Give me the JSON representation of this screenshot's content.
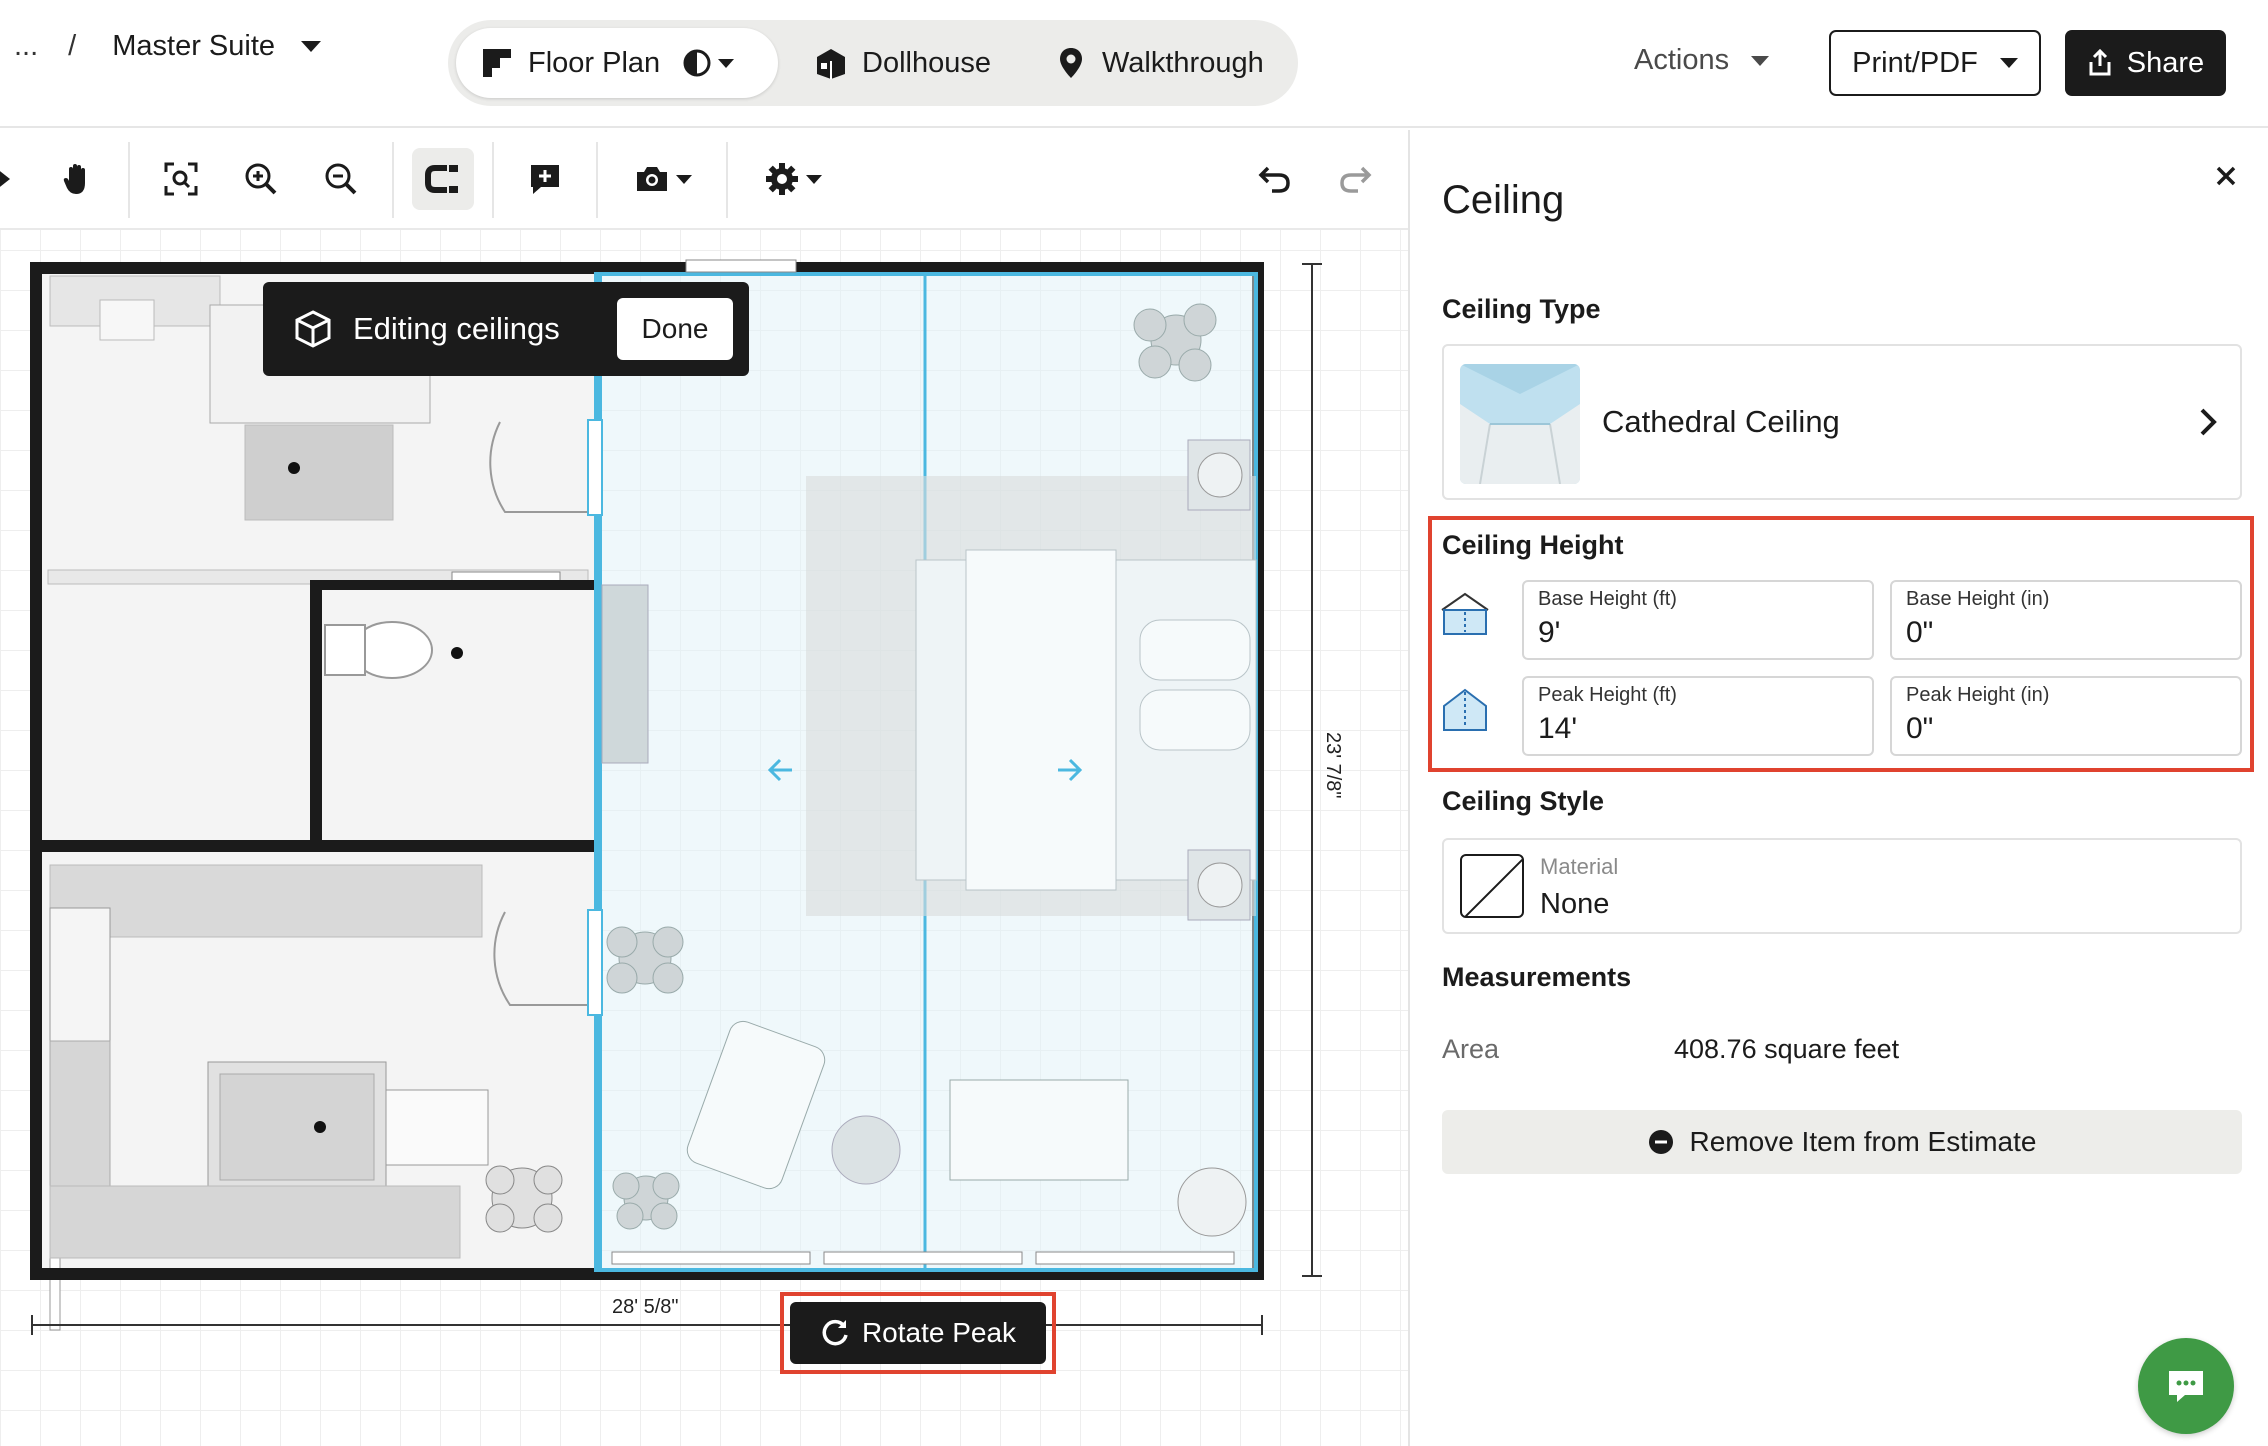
{
  "header": {
    "breadcrumb_ellipsis": "...",
    "breadcrumb_separator": "/",
    "project_title": "Master Suite",
    "modes": [
      {
        "label": "Floor Plan",
        "icon": "floor-plan-icon",
        "active": true
      },
      {
        "label": "Dollhouse",
        "icon": "dollhouse-icon",
        "active": false
      },
      {
        "label": "Walkthrough",
        "icon": "location-pin-icon",
        "active": false
      }
    ],
    "actions_label": "Actions",
    "print_label": "Print/PDF",
    "share_label": "Share"
  },
  "toolbar": {
    "tools": [
      "select-arrow-icon",
      "hand-pan-icon",
      "zoom-fit-icon",
      "zoom-in-icon",
      "zoom-out-icon",
      "magnet-snap-icon",
      "add-comment-icon",
      "camera-icon",
      "settings-gear-icon",
      "undo-icon",
      "redo-icon"
    ],
    "active_tool": "magnet-snap-icon"
  },
  "canvas": {
    "editing_banner": "Editing ceilings",
    "done_label": "Done",
    "rotate_peak_label": "Rotate Peak",
    "width_dimension": "28' 5/8\"",
    "height_dimension": "23' 7/8\""
  },
  "panel": {
    "title": "Ceiling",
    "ceiling_type_label": "Ceiling Type",
    "ceiling_type_value": "Cathedral Ceiling",
    "ceiling_height_label": "Ceiling Height",
    "base_height_ft_label": "Base Height (ft)",
    "base_height_ft_value": "9'",
    "base_height_in_label": "Base Height (in)",
    "base_height_in_value": "0\"",
    "peak_height_ft_label": "Peak Height (ft)",
    "peak_height_ft_value": "14'",
    "peak_height_in_label": "Peak Height (in)",
    "peak_height_in_value": "0\"",
    "ceiling_style_label": "Ceiling Style",
    "material_label": "Material",
    "material_value": "None",
    "measurements_label": "Measurements",
    "area_label": "Area",
    "area_value": "408.76 square feet",
    "remove_label": "Remove Item from Estimate"
  },
  "colors": {
    "highlight_red": "#e0432f",
    "selection_blue": "#4bb8e0",
    "chat_green": "#3f9a45",
    "dark": "#1b1b1b"
  }
}
